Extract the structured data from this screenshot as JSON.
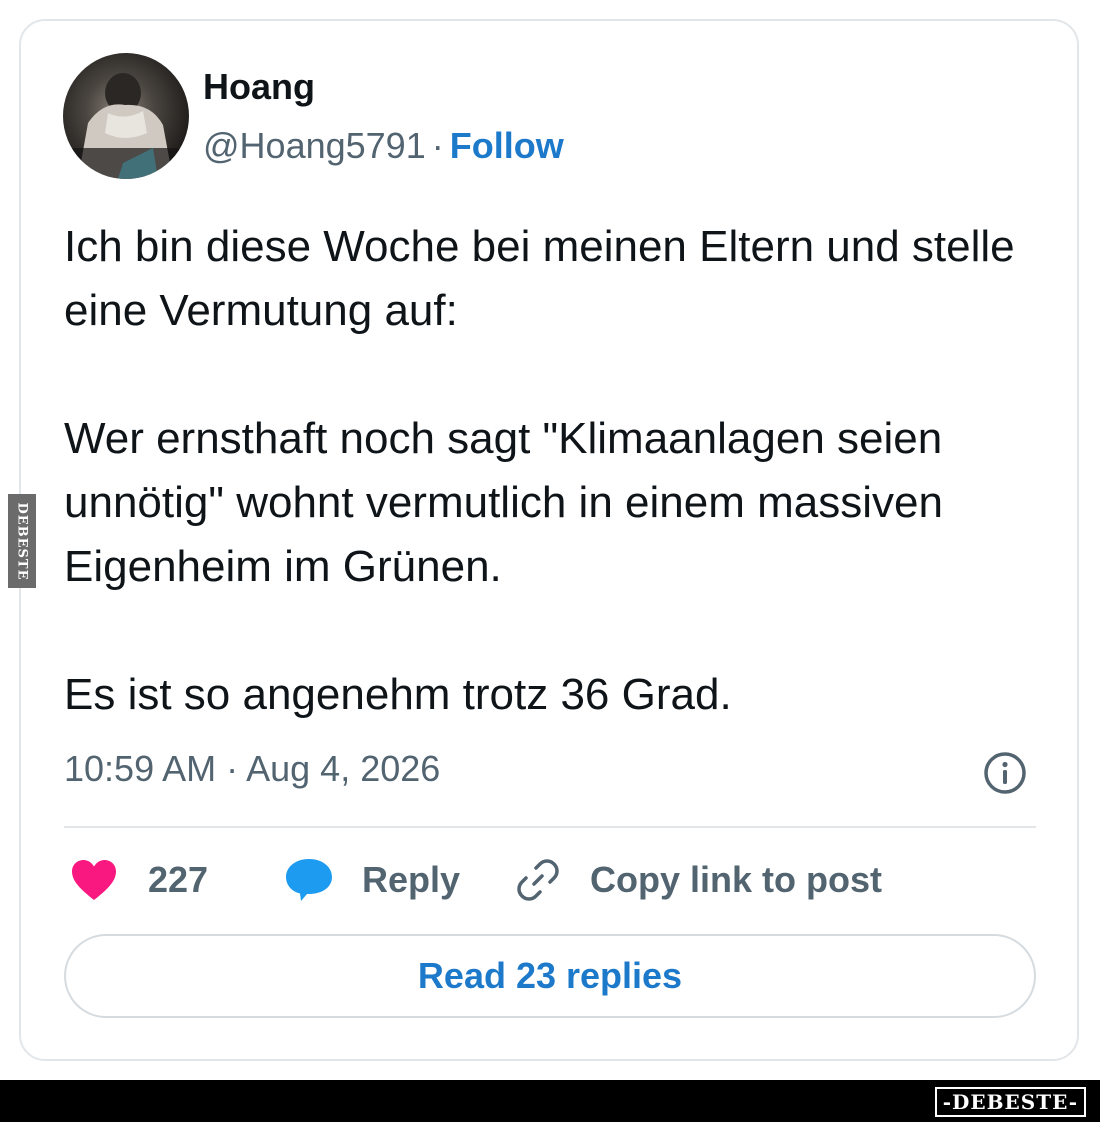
{
  "post": {
    "author": {
      "name": "Hoang",
      "handle": "@Hoang5791",
      "separator": "·",
      "follow_label": "Follow"
    },
    "text": {
      "paragraph_1": "Ich bin diese Woche bei meinen Eltern und stelle eine Vermutung auf:",
      "paragraph_2": "Wer ernsthaft noch sagt \"Klimaanlagen seien unnötig\" wohnt vermutlich in einem massiven Eigenheim im Grünen.",
      "paragraph_3": "Es ist so angenehm trotz 36 Grad."
    },
    "timestamp": "10:59 AM · Aug 4, 2026",
    "actions": {
      "like_count": "227",
      "reply_label": "Reply",
      "copy_link_label": "Copy link to post"
    },
    "read_replies_label": "Read 23 replies"
  },
  "watermark": {
    "side_text": "DEBESTE",
    "bottom_text": "-DEBESTE-"
  },
  "colors": {
    "like": "#f91880",
    "reply": "#1d9bf0",
    "link": "#1d79c9",
    "text_primary": "#0f1419",
    "text_secondary": "#536471",
    "border": "#e3e6e9"
  },
  "icons": [
    "heart-icon",
    "reply-bubble-icon",
    "link-icon",
    "info-icon"
  ]
}
